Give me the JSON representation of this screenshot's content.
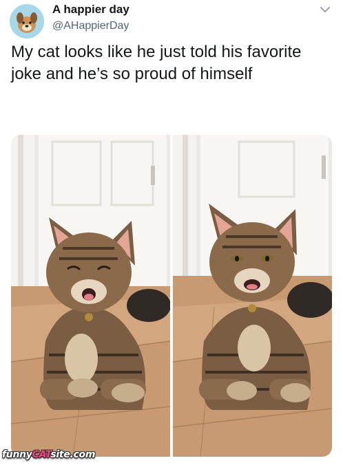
{
  "tweet": {
    "avatar_icon": "dog-avatar-icon",
    "display_name": "A happier day",
    "handle": "@AHappierDay",
    "menu_icon": "chevron-down-icon",
    "text": "My cat looks like he just told his favorite joke and he’s so proud of himself"
  },
  "media": {
    "photos": [
      {
        "description_icon": "cat-laughing-eyes-closed-photo"
      },
      {
        "description_icon": "cat-smiling-eyes-open-photo"
      }
    ]
  },
  "watermark": {
    "prefix": "funny",
    "highlight": "CAT",
    "suffix": "site.com",
    "highlight_color": "#ff3c8c"
  },
  "colors": {
    "text": "#14171a",
    "secondary_text": "#536471",
    "avatar_bg": "#a7d8ea"
  }
}
